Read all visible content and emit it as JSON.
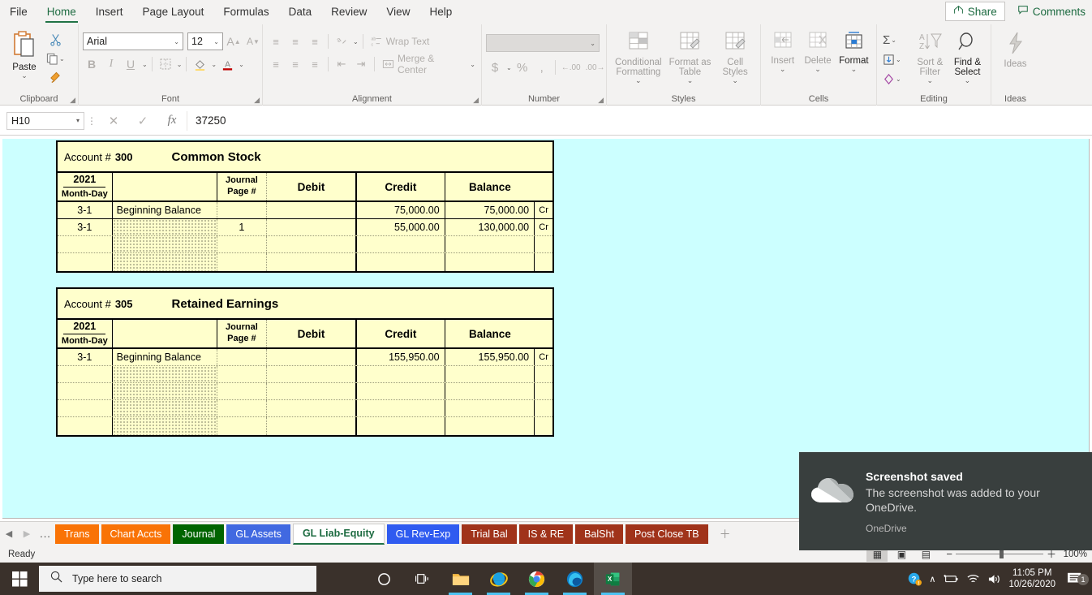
{
  "ribbon": {
    "tabs": [
      {
        "label": "File",
        "active": false
      },
      {
        "label": "Home",
        "active": true
      },
      {
        "label": "Insert",
        "active": false
      },
      {
        "label": "Page Layout",
        "active": false
      },
      {
        "label": "Formulas",
        "active": false
      },
      {
        "label": "Data",
        "active": false
      },
      {
        "label": "Review",
        "active": false
      },
      {
        "label": "View",
        "active": false
      },
      {
        "label": "Help",
        "active": false
      }
    ],
    "share_label": "Share",
    "comments_label": "Comments",
    "groups": {
      "clipboard": {
        "label": "Clipboard",
        "paste_label": "Paste",
        "cut_label": "Cut",
        "copy_label": "Copy",
        "format_painter_label": "Format Painter"
      },
      "font": {
        "label": "Font",
        "font_name": "Arial",
        "font_size": "12",
        "grow_label": "A",
        "shrink_label": "A",
        "bold_label": "B",
        "italic_label": "I",
        "underline_label": "U"
      },
      "alignment": {
        "label": "Alignment",
        "wrap_text_label": "Wrap Text",
        "merge_center_label": "Merge & Center"
      },
      "number": {
        "label": "Number",
        "format_value": "",
        "currency_label": "$",
        "percent_label": "%",
        "comma_label": ","
      },
      "styles": {
        "label": "Styles",
        "conditional_formatting_label": "Conditional Formatting",
        "format_as_table_label": "Format as Table",
        "cell_styles_label": "Cell Styles"
      },
      "cells": {
        "label": "Cells",
        "insert_label": "Insert",
        "delete_label": "Delete",
        "format_label": "Format"
      },
      "editing": {
        "label": "Editing",
        "autosum_label": "Σ",
        "sort_filter_label": "Sort & Filter",
        "find_select_label": "Find & Select"
      },
      "ideas": {
        "label": "Ideas",
        "ideas_label": "Ideas"
      }
    }
  },
  "formula_bar": {
    "name_box": "H10",
    "cancel_label": "✕",
    "enter_label": "✓",
    "fx_label": "fx",
    "formula_value": "37250"
  },
  "ledgers": [
    {
      "account_label": "Account #",
      "account_number": "300",
      "account_name": "Common Stock",
      "headers": {
        "year": "2021",
        "month_day": "Month-Day",
        "description": "",
        "journal_line1": "Journal",
        "journal_line2": "Page #",
        "debit": "Debit",
        "credit": "Credit",
        "balance": "Balance"
      },
      "rows": [
        {
          "date": "3-1",
          "description": "Beginning Balance",
          "journal_page": "",
          "debit": "",
          "credit": "75,000.00",
          "balance": "75,000.00",
          "cr": "Cr",
          "hatched": false
        },
        {
          "date": "3-1",
          "description": "",
          "journal_page": "1",
          "debit": "",
          "credit": "55,000.00",
          "balance": "130,000.00",
          "cr": "Cr",
          "hatched": true
        },
        {
          "date": "",
          "description": "",
          "journal_page": "",
          "debit": "",
          "credit": "",
          "balance": "",
          "cr": "",
          "hatched": true
        },
        {
          "date": "",
          "description": "",
          "journal_page": "",
          "debit": "",
          "credit": "",
          "balance": "",
          "cr": "",
          "hatched": true
        }
      ]
    },
    {
      "account_label": "Account #",
      "account_number": "305",
      "account_name": "Retained Earnings",
      "headers": {
        "year": "2021",
        "month_day": "Month-Day",
        "description": "",
        "journal_line1": "Journal",
        "journal_line2": "Page #",
        "debit": "Debit",
        "credit": "Credit",
        "balance": "Balance"
      },
      "rows": [
        {
          "date": "3-1",
          "description": "Beginning Balance",
          "journal_page": "",
          "debit": "",
          "credit": "155,950.00",
          "balance": "155,950.00",
          "cr": "Cr",
          "hatched": false
        },
        {
          "date": "",
          "description": "",
          "journal_page": "",
          "debit": "",
          "credit": "",
          "balance": "",
          "cr": "",
          "hatched": true
        },
        {
          "date": "",
          "description": "",
          "journal_page": "",
          "debit": "",
          "credit": "",
          "balance": "",
          "cr": "",
          "hatched": true
        },
        {
          "date": "",
          "description": "",
          "journal_page": "",
          "debit": "",
          "credit": "",
          "balance": "",
          "cr": "",
          "hatched": true
        },
        {
          "date": "",
          "description": "",
          "journal_page": "",
          "debit": "",
          "credit": "",
          "balance": "",
          "cr": "",
          "hatched": true
        }
      ]
    }
  ],
  "sheet_tabs": {
    "prev_label": "◀",
    "next_label": "▶",
    "more_label": "...",
    "add_label": "＋",
    "tabs": [
      {
        "label": "Trans",
        "color": "#f97306",
        "text": "#ffffff",
        "active": false
      },
      {
        "label": "Chart Accts",
        "color": "#f97306",
        "text": "#ffffff",
        "active": false
      },
      {
        "label": "Journal",
        "color": "#006400",
        "text": "#ffffff",
        "active": false
      },
      {
        "label": "GL Assets",
        "color": "#4169e1",
        "text": "#ffffff",
        "active": false
      },
      {
        "label": "GL Liab-Equity",
        "color": "#ffffff",
        "text": "#1d6b41",
        "active": true
      },
      {
        "label": "GL Rev-Exp",
        "color": "#2f5bf0",
        "text": "#ffffff",
        "active": false
      },
      {
        "label": "Trial Bal",
        "color": "#a0331a",
        "text": "#ffffff",
        "active": false
      },
      {
        "label": "IS & RE",
        "color": "#a0331a",
        "text": "#ffffff",
        "active": false
      },
      {
        "label": "BalSht",
        "color": "#a0331a",
        "text": "#ffffff",
        "active": false
      },
      {
        "label": "Post Close TB",
        "color": "#a0331a",
        "text": "#ffffff",
        "active": false
      }
    ]
  },
  "status_bar": {
    "ready_label": "Ready",
    "view_normal_label": "▦",
    "view_pagelayout_label": "▣",
    "view_pagebreak_label": "▤",
    "zoom_out_label": "−",
    "zoom_in_label": "＋",
    "zoom_level": "100%"
  },
  "toast": {
    "title": "Screenshot saved",
    "message": "The screenshot was added to your OneDrive.",
    "app_name": "OneDrive",
    "icon": "onedrive-cloud-icon"
  },
  "taskbar": {
    "start_label": "start-icon",
    "search_placeholder": "Type here to search",
    "icons": [
      {
        "name": "cortana-icon",
        "glyph": "◯"
      },
      {
        "name": "task-view-icon",
        "glyph": "❑"
      },
      {
        "name": "file-explorer-icon",
        "glyph": ""
      },
      {
        "name": "internet-explorer-icon",
        "glyph": "e"
      },
      {
        "name": "google-chrome-icon",
        "glyph": ""
      },
      {
        "name": "microsoft-edge-icon",
        "glyph": ""
      },
      {
        "name": "excel-icon",
        "glyph": "X"
      }
    ],
    "tray": {
      "help_label": "?",
      "show_hidden_label": "∧",
      "battery_label": "battery-icon",
      "network_label": "wifi-icon",
      "volume_label": "volume-icon",
      "time": "11:05 PM",
      "date": "10/26/2020",
      "notification_count": "1"
    }
  },
  "colors": {
    "sheet_background": "#ccffff",
    "ledger_fill": "#ffffcc",
    "ribbon_bg": "#f3f2f1",
    "excel_green": "#217346",
    "toast_bg": "#393f3e",
    "taskbar_bg": "#3a312b"
  }
}
